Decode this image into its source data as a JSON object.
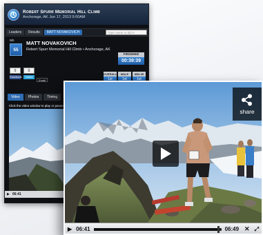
{
  "colors": {
    "accent": "#2f6db3",
    "panel_bg": "#0e1014",
    "controls_bg": "#dcdfe2"
  },
  "race": {
    "title": "Robert Spurr Memorial Hill Climb",
    "subtitle": "Anchorage, AK    Jun 17, 2013 9:00AM"
  },
  "tabs": [
    {
      "label": "Leaders",
      "active": false
    },
    {
      "label": "Results",
      "active": false
    },
    {
      "label": "MATT NOVAKOVICH",
      "active": true
    }
  ],
  "search": {
    "placeholder": "Type name or bib #"
  },
  "athlete": {
    "bib_label": "Bib",
    "bib": "55",
    "name": "Matt Novakovich",
    "race_line": "Robert Spurr Memorial Hill Climb • Anchorage, AK"
  },
  "finish": {
    "label": "Finished",
    "time": "00:39:39"
  },
  "social": {
    "facebook_count": "0",
    "facebook_label": "Facebook",
    "twitter_count": "0",
    "twitter_label": "Twitter",
    "email_label": "Email"
  },
  "ranks": [
    {
      "label": "Overall",
      "value": "1st"
    },
    {
      "label": "Male",
      "value": "1st"
    },
    {
      "label": "M30-39",
      "value": "1st"
    }
  ],
  "media_tabs": [
    {
      "label": "Video",
      "active": true
    },
    {
      "label": "Photos",
      "active": false
    },
    {
      "label": "Timing",
      "active": false
    }
  ],
  "hint": "Click the video window to play or pause",
  "small_player": {
    "time": "06:41"
  },
  "player": {
    "share_label": "share",
    "current_time": "06:41",
    "duration": "06:49",
    "progress": 0.98
  }
}
